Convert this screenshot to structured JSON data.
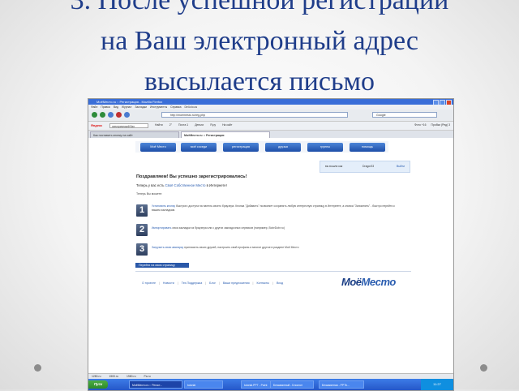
{
  "slide": {
    "title_lines": [
      "3. После успешной регистрации",
      "на Ваш электронный адрес",
      "высылается письмо"
    ]
  },
  "browser": {
    "title": "МоёМесто.ru :: Регистрация - Mozilla Firefox",
    "menu": [
      "Файл",
      "Правка",
      "Вид",
      "Журнал",
      "Закладки",
      "Инструменты",
      "Справка",
      "Del.icio.us"
    ],
    "address": "http://moemesto.ru/reg.php",
    "search_placeholder": "Google",
    "toolbar2": {
      "brand": "Яндекс",
      "search_value": "электрический бал",
      "items": [
        "Найти",
        "2°",
        "Почта 1",
        "Деньги",
        "Я.ру",
        "На сайт"
      ],
      "right": [
        "Фото +16",
        "Пробки (Ред) 3"
      ]
    },
    "tabs": [
      "Как поставить кнопку на сайт",
      "МоёМесто.ru :: Регистрация"
    ]
  },
  "site": {
    "nav": [
      "Моё Место",
      "моё соседи",
      "регистрация",
      "друзья",
      "группы",
      "помощь"
    ],
    "login": {
      "prefix": "вы вошли как",
      "user": "Dragor33",
      "exit": "Выйти"
    },
    "congrats": "Поздравляем! Вы успешно зарегистрировались!",
    "sub_prefix": "Теперь у вас есть",
    "sub_link": "Своё Собственное Место",
    "sub_suffix": "в Интернете!",
    "now": "Теперь Вы можете:",
    "steps": [
      {
        "num": "1",
        "link": "Установить кнопку",
        "text": "быстрого доступа на панель своего браузера. Кнопка \"Добавить\" позволяет сохранять любую интересную страницу в Интернете, а кнопка \"Запомнить\" - быстро перейти к вашим закладкам."
      },
      {
        "num": "2",
        "link": "Импортировать",
        "text": "свои закладки из браузера или с других закладочных сервисов (например, BobrDobr.ru)"
      },
      {
        "num": "3",
        "link": "Загрузить свою аватарку",
        "text": "пригласить своих друзей, настроить свой профиль и многое другое в разделе Моё Место"
      }
    ],
    "go_button": "Перейти на свою страницу",
    "footer": [
      "О проекте",
      "Новости",
      "Тех.Поддержка",
      "Блог",
      "Ваши предложения",
      "Контакты",
      "Вход"
    ],
    "logo_main": "Моё",
    "logo_tail": "Место"
  },
  "statusbar": [
    "1280.ru",
    "1500.ru",
    "1980.ru",
    "Pa.ru"
  ],
  "taskbar": {
    "start": "Пуск",
    "tasks": [
      "МоёМесто.ru :: Регист...",
      "tutorial",
      "tutorial.PPT - Paint",
      "Безымянный - Блокнот",
      "Безымянная - PPTb..."
    ],
    "clock": "11:27"
  }
}
